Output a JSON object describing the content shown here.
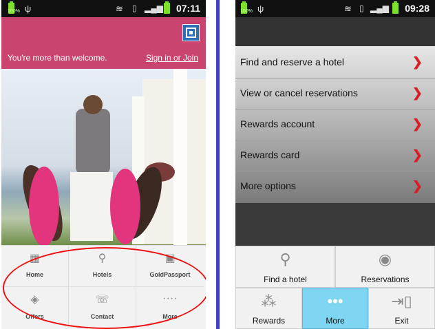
{
  "left_screen": {
    "status": {
      "time": "07:11",
      "carrier_badge": "100%"
    },
    "welcome_text": "You're more than welcome.",
    "signin_link": "Sign in or Join",
    "grid": [
      {
        "label": "Home",
        "icon": "grid-icon"
      },
      {
        "label": "Hotels",
        "icon": "search-icon"
      },
      {
        "label": "GoldPassport",
        "icon": "card-icon"
      },
      {
        "label": "Offers",
        "icon": "tag-icon"
      },
      {
        "label": "Contact",
        "icon": "phone-icon"
      },
      {
        "label": "More",
        "icon": "more-icon"
      }
    ]
  },
  "right_screen": {
    "status": {
      "time": "09:28",
      "carrier_badge": "100%"
    },
    "menu": [
      {
        "label": "Find and reserve a hotel"
      },
      {
        "label": "View or cancel reservations"
      },
      {
        "label": "Rewards account"
      },
      {
        "label": "Rewards card"
      },
      {
        "label": "More options"
      }
    ],
    "tabs": [
      {
        "label": "Find a hotel",
        "icon": "search-icon"
      },
      {
        "label": "Reservations",
        "icon": "globe-icon"
      },
      {
        "label": "Rewards",
        "icon": "spinner-icon"
      },
      {
        "label": "More",
        "icon": "more-icon",
        "active": true
      },
      {
        "label": "Exit",
        "icon": "exit-icon"
      }
    ]
  },
  "colors": {
    "brand_pink": "#c9456f",
    "chevron_red": "#d81f26",
    "active_tab": "#7fd6f2",
    "annotation_red": "#e11"
  }
}
